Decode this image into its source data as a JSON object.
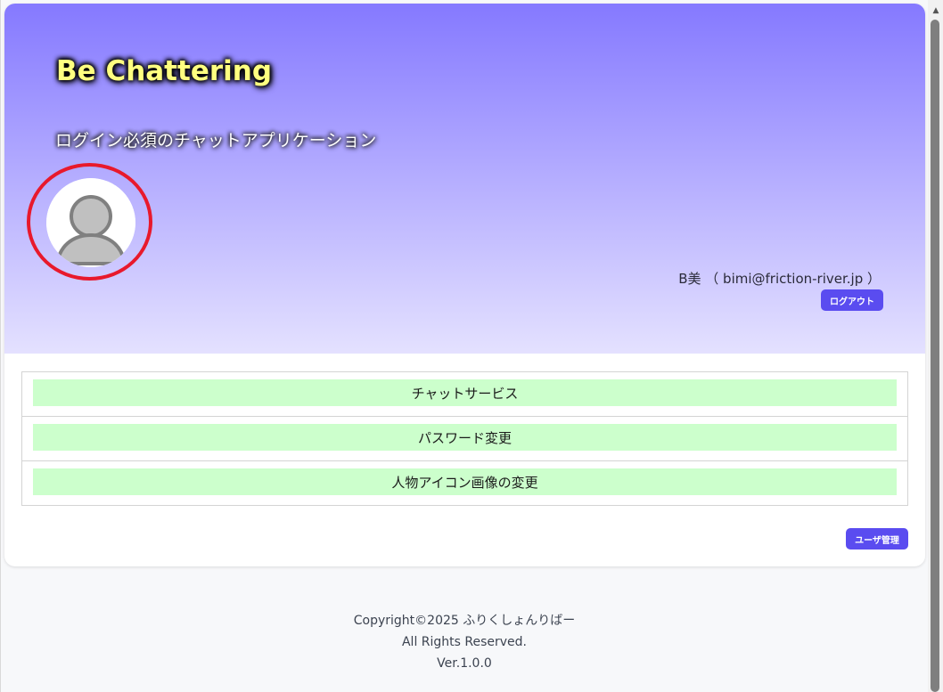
{
  "header": {
    "title": "Be Chattering",
    "subtitle": "ログイン必須のチャットアプリケーション"
  },
  "user": {
    "display": "B美 （ bimi@friction-river.jp ）",
    "logout_label": "ログアウト"
  },
  "menu": {
    "items": [
      {
        "label": "チャットサービス"
      },
      {
        "label": "パスワード変更"
      },
      {
        "label": "人物アイコン画像の変更"
      }
    ]
  },
  "admin": {
    "label": "ユーザ管理"
  },
  "footer": {
    "copyright": "Copyright©2025 ふりくしょんりばー",
    "rights": "All Rights Reserved.",
    "version": "Ver.1.0.0"
  },
  "colors": {
    "header_top": "#8579ff",
    "header_bottom": "#e4e1ff",
    "primary_button": "#5a4cf0",
    "menu_button": "#ccffcc",
    "avatar_ring": "#e8192c",
    "title_text": "#ffff80"
  },
  "icons": {
    "avatar": "person-silhouette-icon",
    "scroll_up": "triangle-up-icon"
  }
}
